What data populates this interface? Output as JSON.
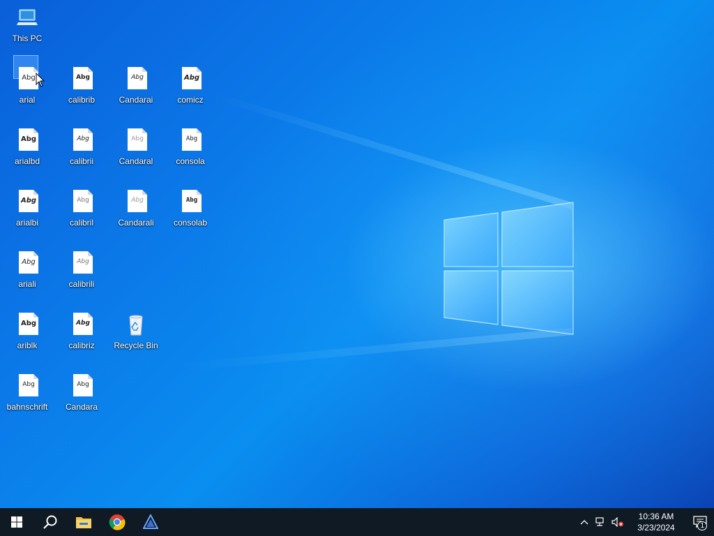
{
  "desktop_icons": [
    {
      "label": "This PC",
      "type": "computer"
    },
    {
      "label": "arial",
      "type": "font",
      "sample": "Abg"
    },
    {
      "label": "arialbd",
      "type": "font",
      "sample": "Abg"
    },
    {
      "label": "arialbi",
      "type": "font",
      "sample": "Abg"
    },
    {
      "label": "ariali",
      "type": "font",
      "sample": "Abg"
    },
    {
      "label": "ariblk",
      "type": "font",
      "sample": "Abg"
    },
    {
      "label": "bahnschrift",
      "type": "font",
      "sample": "Abg"
    },
    {
      "label": "calibrib",
      "type": "font",
      "sample": "Abg"
    },
    {
      "label": "calibrii",
      "type": "font",
      "sample": "Abg"
    },
    {
      "label": "calibril",
      "type": "font",
      "sample": "Abg"
    },
    {
      "label": "calibrili",
      "type": "font",
      "sample": "Abg"
    },
    {
      "label": "calibriz",
      "type": "font",
      "sample": "Abg"
    },
    {
      "label": "Candara",
      "type": "font",
      "sample": "Abg"
    },
    {
      "label": "Candarai",
      "type": "font",
      "sample": "Abg"
    },
    {
      "label": "Candaral",
      "type": "font",
      "sample": "Abg"
    },
    {
      "label": "Candarali",
      "type": "font",
      "sample": "Abg"
    },
    {
      "label": "Recycle Bin",
      "type": "recycle-bin"
    },
    {
      "label": "comicz",
      "type": "font",
      "sample": "Abg"
    },
    {
      "label": "consola",
      "type": "font",
      "sample": "Abg"
    },
    {
      "label": "consolab",
      "type": "font",
      "sample": "Abg"
    }
  ],
  "taskbar": {
    "apps": [
      "start-icon",
      "search-icon",
      "file-explorer-icon",
      "chrome-icon",
      "app-icon"
    ],
    "tray": {
      "time": "10:36 AM",
      "date": "3/23/2024",
      "notification_count": "1"
    }
  },
  "colors": {
    "taskbar": "#0f1a24",
    "wallpaper": "#0a78e8",
    "accent": "#4fc3ff"
  }
}
